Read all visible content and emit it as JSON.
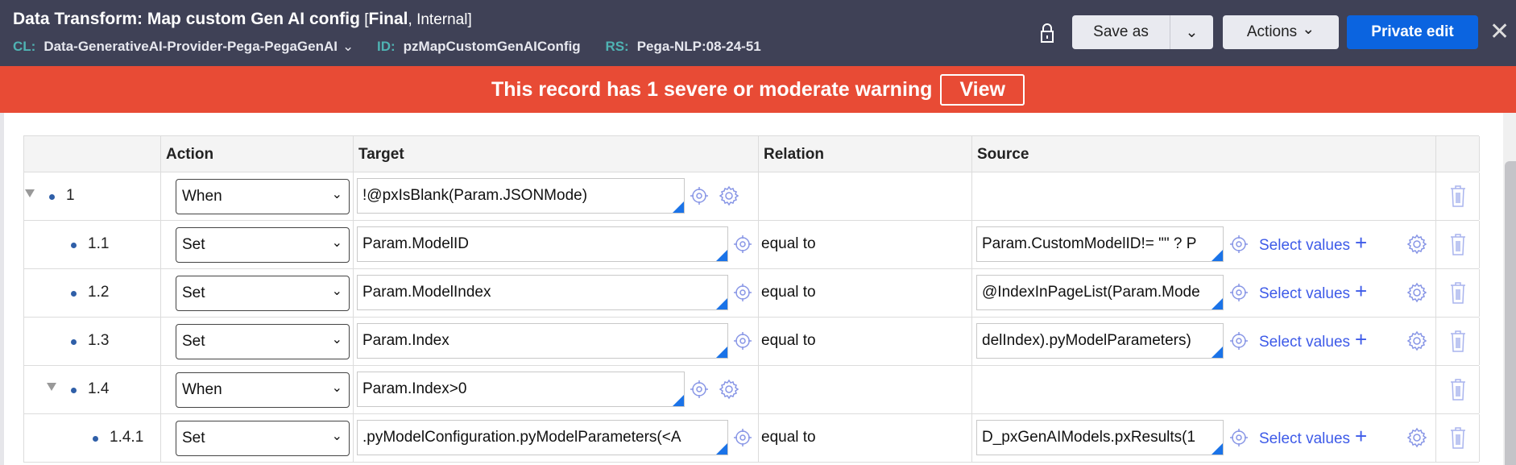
{
  "header": {
    "title_main": "Data Transform: Map custom Gen AI config",
    "title_bracket_open": " [",
    "title_final": "Final",
    "title_internal": ", Internal]",
    "cl_label": "CL:",
    "cl_value": "Data-GenerativeAI-Provider-Pega-PegaGenAI",
    "id_label": "ID:",
    "id_value": "pzMapCustomGenAIConfig",
    "rs_label": "RS:",
    "rs_value": "Pega-NLP:08-24-51",
    "save_as": "Save as",
    "actions": "Actions",
    "private_edit": "Private edit"
  },
  "banner": {
    "message": "This record has 1 severe or moderate warning",
    "view": "View"
  },
  "table": {
    "columns": [
      "",
      "Action",
      "Target",
      "Relation",
      "Source",
      ""
    ],
    "select_values_label": "Select values",
    "rows": [
      {
        "step": "1",
        "level": 0,
        "expandable": true,
        "action": "When",
        "target": "!@pxIsBlank(Param.JSONMode)",
        "relation": "",
        "source": ""
      },
      {
        "step": "1.1",
        "level": 1,
        "expandable": false,
        "action": "Set",
        "target": "Param.ModelID",
        "relation": "equal to",
        "source": "Param.CustomModelID!= \"\" ? P"
      },
      {
        "step": "1.2",
        "level": 1,
        "expandable": false,
        "action": "Set",
        "target": "Param.ModelIndex",
        "relation": "equal to",
        "source": "@IndexInPageList(Param.Mode"
      },
      {
        "step": "1.3",
        "level": 1,
        "expandable": false,
        "action": "Set",
        "target": "Param.Index",
        "relation": "equal to",
        "source": "delIndex).pyModelParameters)"
      },
      {
        "step": "1.4",
        "level": 1,
        "expandable": true,
        "action": "When",
        "target": "Param.Index>0",
        "relation": "",
        "source": ""
      },
      {
        "step": "1.4.1",
        "level": 2,
        "expandable": false,
        "action": "Set",
        "target": ".pyModelConfiguration.pyModelParameters(<A",
        "relation": "equal to",
        "source": "D_pxGenAIModels.pxResults(1"
      }
    ]
  },
  "colors": {
    "header_bg": "#3f4156",
    "banner_bg": "#e84b35",
    "primary": "#0b64e0",
    "link": "#3d5ae8"
  }
}
